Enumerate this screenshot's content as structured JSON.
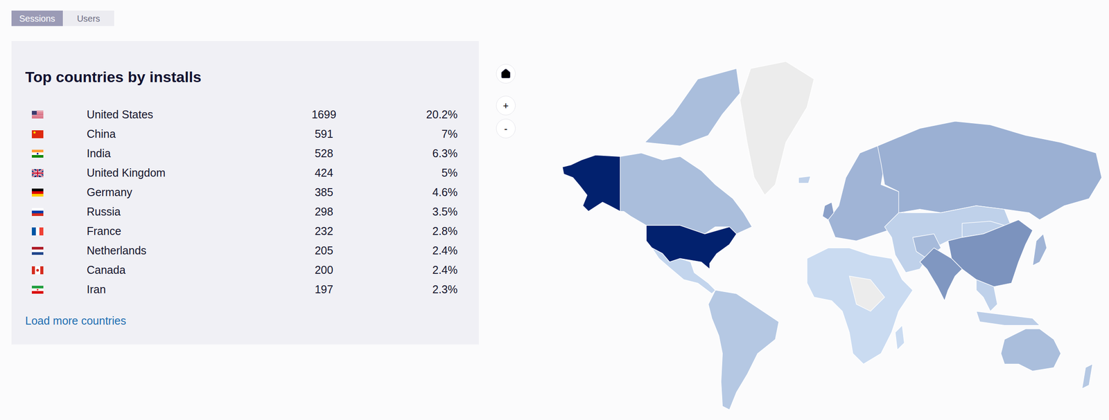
{
  "tabs": [
    {
      "label": "Sessions",
      "selected": true
    },
    {
      "label": "Users",
      "selected": false
    }
  ],
  "panel": {
    "title": "Top countries by installs",
    "rows": [
      {
        "kind": "us",
        "country": "United States",
        "installs": "1699",
        "share": "20.2%"
      },
      {
        "kind": "cn",
        "country": "China",
        "installs": "591",
        "share": "7%"
      },
      {
        "kind": "in",
        "country": "India",
        "installs": "528",
        "share": "6.3%"
      },
      {
        "kind": "gb",
        "country": "United Kingdom",
        "installs": "424",
        "share": "5%"
      },
      {
        "kind": "de",
        "country": "Germany",
        "installs": "385",
        "share": "4.6%"
      },
      {
        "kind": "ru",
        "country": "Russia",
        "installs": "298",
        "share": "3.5%"
      },
      {
        "kind": "fr",
        "country": "France",
        "installs": "232",
        "share": "2.8%"
      },
      {
        "kind": "nl",
        "country": "Netherlands",
        "installs": "205",
        "share": "2.4%"
      },
      {
        "kind": "ca",
        "country": "Canada",
        "installs": "200",
        "share": "2.4%"
      },
      {
        "kind": "ir",
        "country": "Iran",
        "installs": "197",
        "share": "2.3%"
      }
    ],
    "link": "Load more countries"
  },
  "controls": {
    "zoom_in": "+",
    "zoom_out": "-"
  },
  "map": {
    "regions": [
      {
        "kind": "greenland",
        "has_data": false,
        "level": 0
      },
      {
        "kind": "canada",
        "has_data": true,
        "level": 0.2
      },
      {
        "kind": "arctic",
        "has_data": true,
        "level": 0.2
      },
      {
        "kind": "alaska",
        "has_data": true,
        "level": 1
      },
      {
        "kind": "usa",
        "has_data": true,
        "level": 1
      },
      {
        "kind": "mexico",
        "has_data": true,
        "level": 0.08
      },
      {
        "kind": "southamerica",
        "has_data": true,
        "level": 0.15
      },
      {
        "kind": "iceland",
        "has_data": true,
        "level": 0.1
      },
      {
        "kind": "europe",
        "has_data": true,
        "level": 0.25
      },
      {
        "kind": "uk",
        "has_data": true,
        "level": 0.35
      },
      {
        "kind": "russia",
        "has_data": true,
        "level": 0.27
      },
      {
        "kind": "centralasia",
        "has_data": true,
        "level": 0.1
      },
      {
        "kind": "mongolia",
        "has_data": true,
        "level": 0.1
      },
      {
        "kind": "iran",
        "has_data": true,
        "level": 0.22
      },
      {
        "kind": "china",
        "has_data": true,
        "level": 0.42
      },
      {
        "kind": "india",
        "has_data": true,
        "level": 0.4
      },
      {
        "kind": "seasia",
        "has_data": true,
        "level": 0.1
      },
      {
        "kind": "indonesia",
        "has_data": true,
        "level": 0.12
      },
      {
        "kind": "japan",
        "has_data": true,
        "level": 0.25
      },
      {
        "kind": "africa",
        "has_data": true,
        "level": 0.05
      },
      {
        "kind": "centralafrica",
        "has_data": false,
        "level": 0
      },
      {
        "kind": "madagascar",
        "has_data": true,
        "level": 0.05
      },
      {
        "kind": "australia",
        "has_data": true,
        "level": 0.2
      },
      {
        "kind": "newzealand",
        "has_data": true,
        "level": 0.15
      }
    ]
  }
}
